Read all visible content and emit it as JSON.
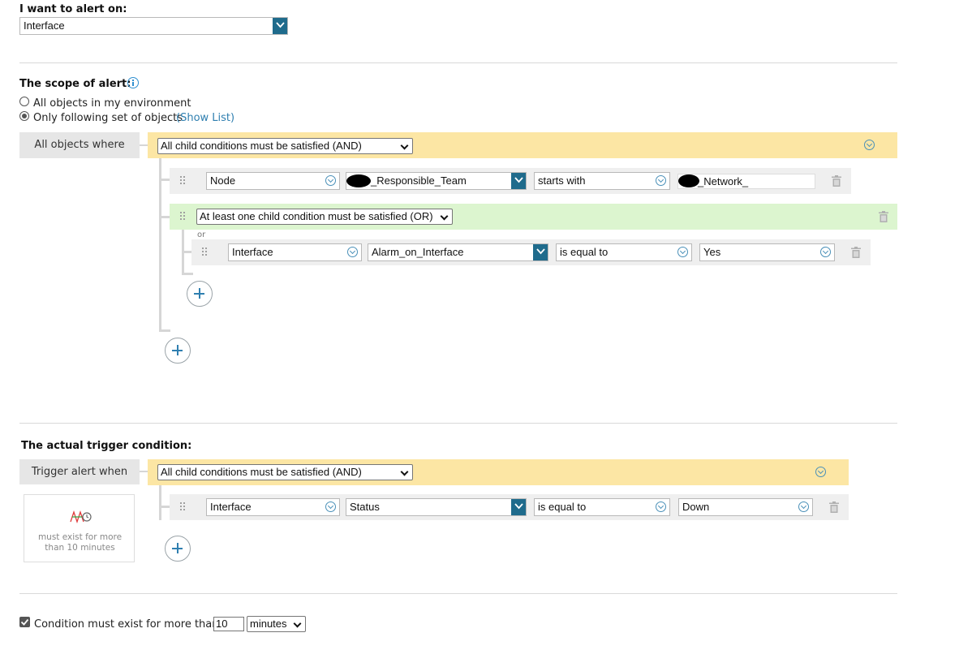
{
  "alert_on": {
    "label": "I want to alert on:",
    "value": "Interface"
  },
  "scope": {
    "label": "The scope of alert:",
    "option_all": "All objects in my environment",
    "option_only": "Only following set of objects",
    "show_list": "(Show List)",
    "selected": "only"
  },
  "scope_group": {
    "where_label": "All objects where",
    "root_mode": "All child conditions must be satisfied (AND)",
    "condition1": {
      "object": "Node",
      "field": "_Responsible_Team",
      "operator": "starts with",
      "value": "_Network_"
    },
    "subgroup": {
      "mode": "At least one child condition must be satisfied (OR)",
      "or_label": "or",
      "condition": {
        "object": "Interface",
        "field": "Alarm_on_Interface",
        "operator": "is equal to",
        "value": "Yes"
      }
    }
  },
  "trigger": {
    "label": "The actual trigger condition:",
    "when_label": "Trigger alert when",
    "mode": "All child conditions must be satisfied (AND)",
    "condition": {
      "object": "Interface",
      "field": "Status",
      "operator": "is equal to",
      "value": "Down"
    },
    "badge_text": "must exist for more than 10 minutes"
  },
  "duration": {
    "checkbox_label": "Condition must exist for more than",
    "checked": true,
    "value": "10",
    "unit": "minutes"
  },
  "colors": {
    "and_band": "#fce6a4",
    "or_band": "#dcf5cf",
    "accent": "#1f6b8c",
    "link": "#2f7fb0"
  }
}
